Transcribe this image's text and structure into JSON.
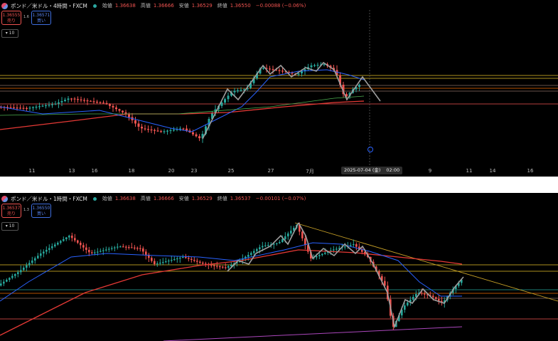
{
  "top_panel": {
    "title": "ポンド／米ドル・4時間・FXCM",
    "ohlc": [
      {
        "label": "始値",
        "value": "1.36638"
      },
      {
        "label": "高値",
        "value": "1.36666"
      },
      {
        "label": "安値",
        "value": "1.36529"
      },
      {
        "label": "終値",
        "value": "1.36550"
      }
    ],
    "change": "−0.00088 (−0.06%)",
    "sell": {
      "price": "1.36555",
      "label": "売り"
    },
    "spread": "1.6",
    "buy": {
      "price": "1.36571",
      "label": "買い"
    },
    "indicator_count": "10",
    "x_labels": [
      "11",
      "13",
      "16",
      "18",
      "20",
      "23",
      "25",
      "27",
      "7月",
      "9",
      "11",
      "14",
      "16"
    ],
    "crosshair_date": "2025-07-04 (金)",
    "crosshair_time": "02:00"
  },
  "bottom_panel": {
    "title": "ポンド／米ドル・1時間・FXCM",
    "ohlc": [
      {
        "label": "始値",
        "value": "1.36638"
      },
      {
        "label": "高値",
        "value": "1.36666"
      },
      {
        "label": "安値",
        "value": "1.36529"
      },
      {
        "label": "終値",
        "value": "1.36537"
      }
    ],
    "change": "−0.00101 (−0.07%)",
    "sell": {
      "price": "1.36537",
      "label": "売り"
    },
    "spread": "1.3",
    "buy": {
      "price": "1.36550",
      "label": "買い"
    },
    "indicator_count": "10"
  },
  "colors": {
    "up": "#26a69a",
    "down": "#ef5350",
    "ma_fast": "#2962ff",
    "ma_slow": "#e53935",
    "zigzag": "#9e9e9e",
    "level_yellow": "#e6c229",
    "level_orange": "#ef6c00",
    "trend_purple": "#ab47bc"
  }
}
